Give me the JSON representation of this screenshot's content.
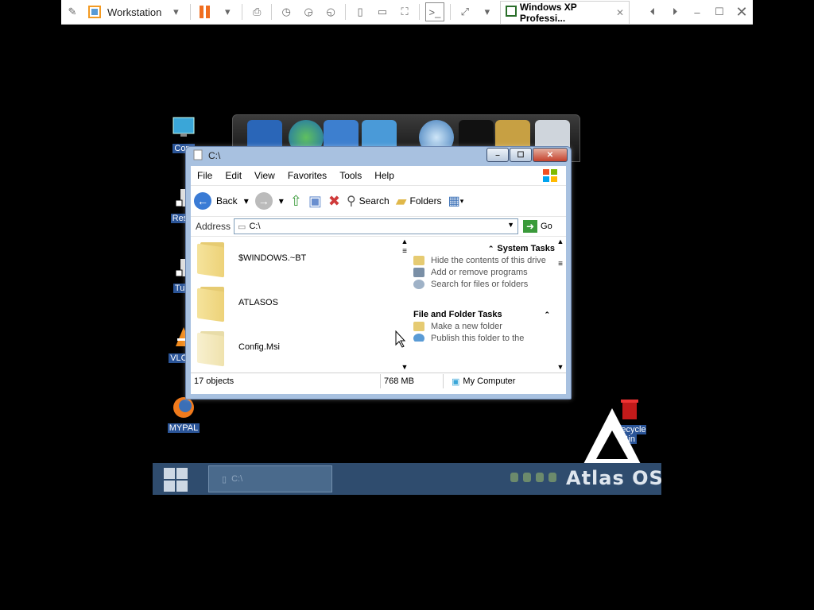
{
  "vmware": {
    "workstation_label": "Workstation",
    "tab_title": "Windows XP Professi...",
    "tab_close": "✕"
  },
  "desktop": {
    "icons": [
      {
        "label": "Com"
      },
      {
        "label": "Resta"
      },
      {
        "label": "Turn"
      },
      {
        "label": "VLC m"
      },
      {
        "label": "MYPAL"
      }
    ],
    "recycle_bin_label": "Recycle Bin"
  },
  "explorer": {
    "title": "C:\\",
    "menu": [
      "File",
      "Edit",
      "View",
      "Favorites",
      "Tools",
      "Help"
    ],
    "toolbar": {
      "back_label": "Back",
      "search_label": "Search",
      "folders_label": "Folders"
    },
    "address": {
      "label": "Address",
      "value": "C:\\",
      "go_label": "Go"
    },
    "files": [
      {
        "name": "$WINDOWS.~BT"
      },
      {
        "name": "ATLASOS"
      },
      {
        "name": "Config.Msi"
      }
    ],
    "tasks": {
      "system_tasks_title": "System Tasks",
      "system_items": [
        "Hide the contents of this drive",
        "Add or remove programs",
        "Search for files or folders"
      ],
      "file_folder_title": "File and Folder Tasks",
      "file_items": [
        "Make a new folder",
        "Publish this folder to the"
      ]
    },
    "status": {
      "objects": "17 objects",
      "size": "768 MB",
      "location": "My Computer"
    }
  },
  "taskbar": {
    "task_label": "C:\\",
    "brand_text": "Atlas OS"
  },
  "colors": {
    "desktop_bg": "#000000",
    "taskbar_bg": "#2f4c6e",
    "vm_pause_accent": "#f06d1e"
  }
}
